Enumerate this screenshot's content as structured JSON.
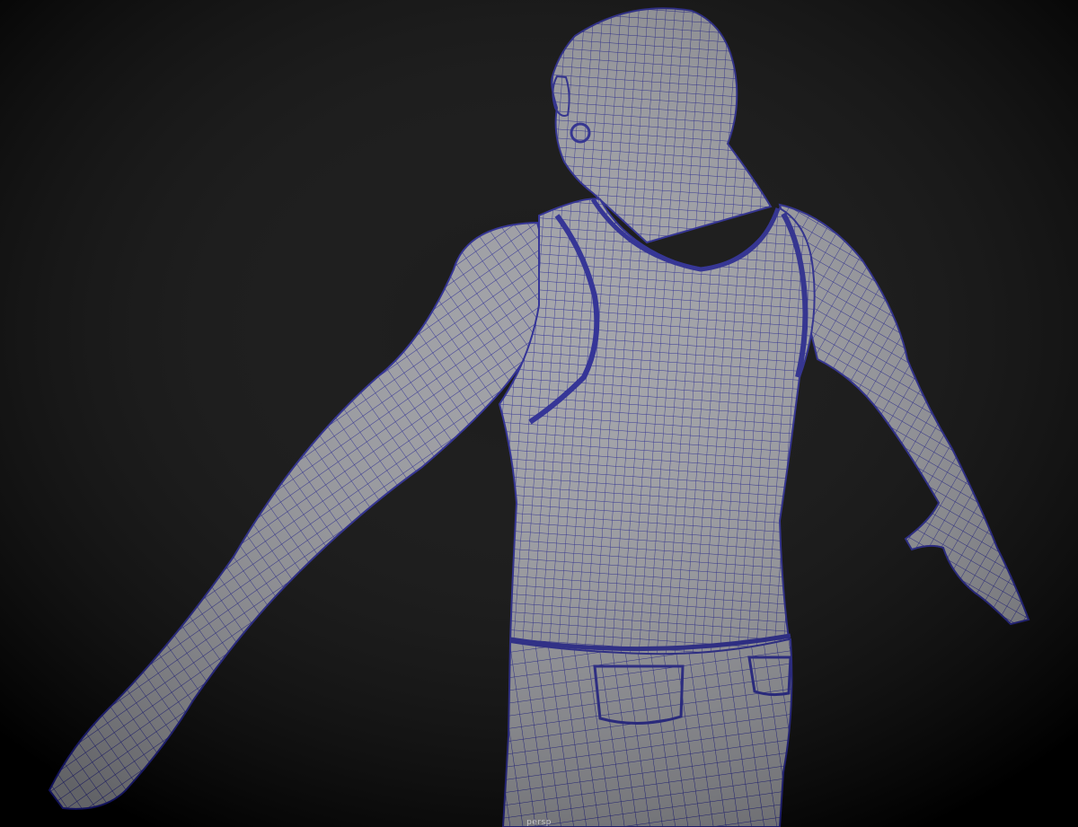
{
  "viewport": {
    "camera_label": "persp",
    "background_color": "#000000",
    "mesh_fill_color": "#999aa0",
    "wire_color": "#1c1c8c"
  },
  "model": {
    "name_icon": "wireframe-character-model"
  }
}
